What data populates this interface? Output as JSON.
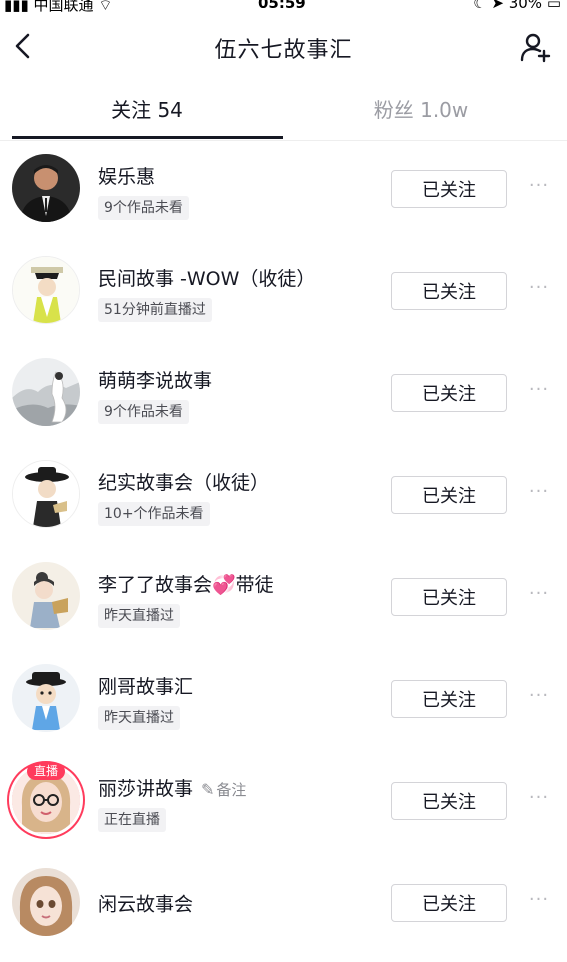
{
  "status_bar": {
    "carrier": "中国联通",
    "time": "05:59",
    "battery": "30%"
  },
  "nav": {
    "title": "伍六七故事汇"
  },
  "tabs": {
    "following": "关注 54",
    "fans": "粉丝 1.0w"
  },
  "follow_label": "已关注",
  "more_label": "···",
  "users": [
    {
      "name": "娱乐惠",
      "sub": "9个作品未看",
      "live": false
    },
    {
      "name": "民间故事 -WOW（收徒）",
      "sub": "51分钟前直播过",
      "live": false
    },
    {
      "name": "萌萌李说故事",
      "sub": "9个作品未看",
      "live": false
    },
    {
      "name": "纪实故事会（收徒）",
      "sub": "10+个作品未看",
      "live": false
    },
    {
      "name": "李了了故事会💞带徒",
      "sub": "昨天直播过",
      "live": false
    },
    {
      "name": "刚哥故事汇",
      "sub": "昨天直播过",
      "live": false
    },
    {
      "name": "丽莎讲故事",
      "sub": "正在直播",
      "live": true,
      "live_badge": "直播",
      "remark": "备注"
    },
    {
      "name": "闲云故事会",
      "sub": "",
      "live": false
    }
  ],
  "colors": {
    "live_red": "#ff3b5c",
    "text_primary": "#161823",
    "text_secondary": "#9b9ca3"
  }
}
